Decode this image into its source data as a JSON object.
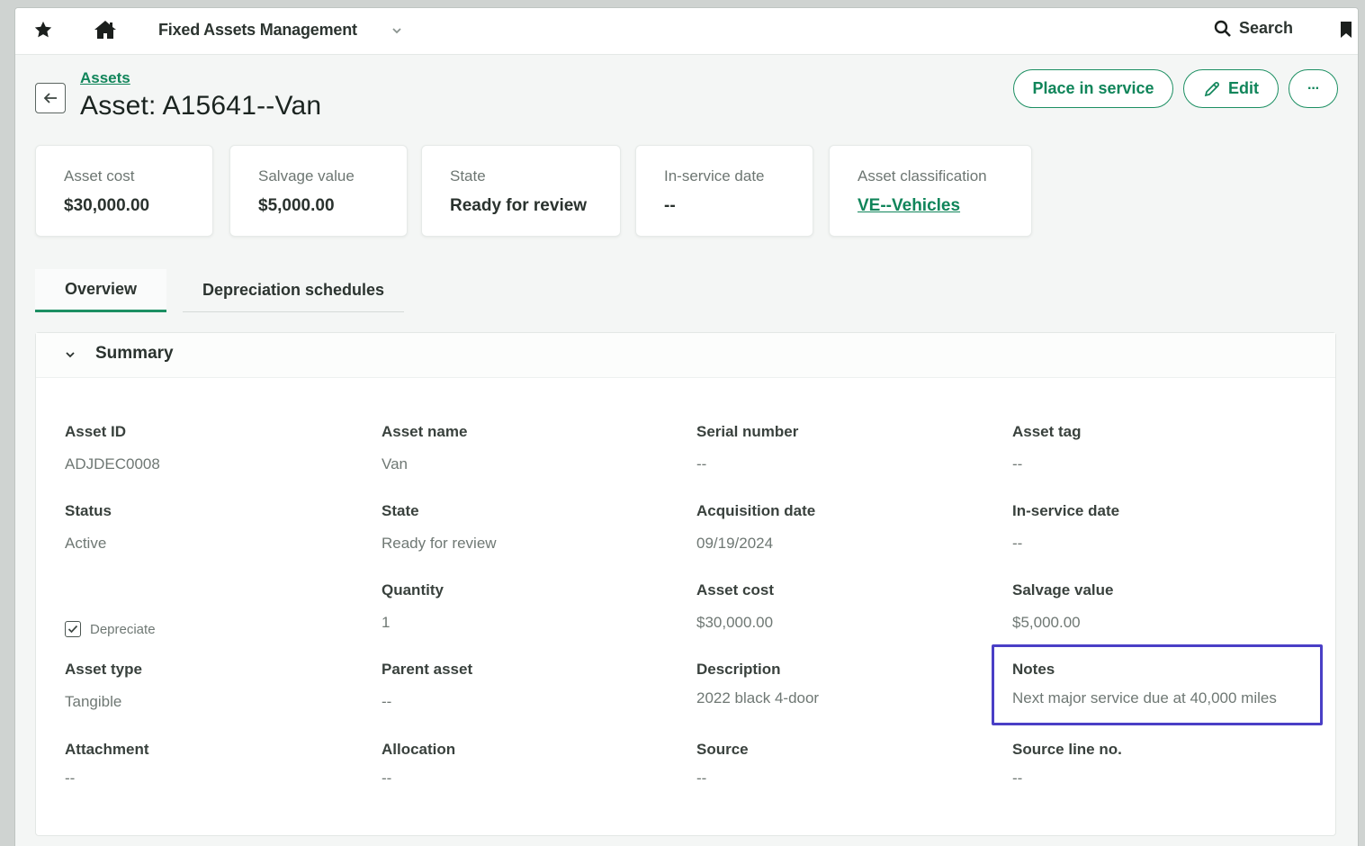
{
  "topbar": {
    "app_title": "Fixed Assets Management",
    "search_label": "Search"
  },
  "header": {
    "breadcrumb": "Assets",
    "title": "Asset: A15641--Van",
    "buttons": {
      "place_in_service": "Place in service",
      "edit": "Edit",
      "more": "···"
    }
  },
  "cards": [
    {
      "label": "Asset cost",
      "value": "$30,000.00"
    },
    {
      "label": "Salvage value",
      "value": "$5,000.00"
    },
    {
      "label": "State",
      "value": "Ready for review"
    },
    {
      "label": "In-service date",
      "value": "--"
    },
    {
      "label": "Asset classification",
      "value": "VE--Vehicles"
    }
  ],
  "tabs": [
    {
      "label": "Overview",
      "active": true
    },
    {
      "label": "Depreciation schedules",
      "active": false
    }
  ],
  "summary": {
    "title": "Summary",
    "depreciate_label": "Depreciate",
    "depreciate_checked": true,
    "fields": {
      "asset_id": {
        "label": "Asset ID",
        "value": "ADJDEC0008"
      },
      "asset_name": {
        "label": "Asset name",
        "value": "Van"
      },
      "serial_number": {
        "label": "Serial number",
        "value": "--"
      },
      "asset_tag": {
        "label": "Asset tag",
        "value": "--"
      },
      "status": {
        "label": "Status",
        "value": "Active"
      },
      "state": {
        "label": "State",
        "value": "Ready for review"
      },
      "acquisition_date": {
        "label": "Acquisition date",
        "value": "09/19/2024"
      },
      "in_service_date": {
        "label": "In-service date",
        "value": "--"
      },
      "quantity": {
        "label": "Quantity",
        "value": "1"
      },
      "asset_cost": {
        "label": "Asset cost",
        "value": "$30,000.00"
      },
      "salvage_value": {
        "label": "Salvage value",
        "value": "$5,000.00"
      },
      "asset_type": {
        "label": "Asset type",
        "value": "Tangible"
      },
      "parent_asset": {
        "label": "Parent asset",
        "value": "--"
      },
      "description": {
        "label": "Description",
        "value": "2022 black 4-door"
      },
      "notes": {
        "label": "Notes",
        "value": "Next major service due at 40,000 miles"
      },
      "attachment": {
        "label": "Attachment",
        "value": "--"
      },
      "allocation": {
        "label": "Allocation",
        "value": "--"
      },
      "source": {
        "label": "Source",
        "value": "--"
      },
      "source_line_no": {
        "label": "Source line no.",
        "value": "--"
      }
    }
  },
  "colors": {
    "accent": "#10855a",
    "highlight": "#4a3fc6"
  }
}
